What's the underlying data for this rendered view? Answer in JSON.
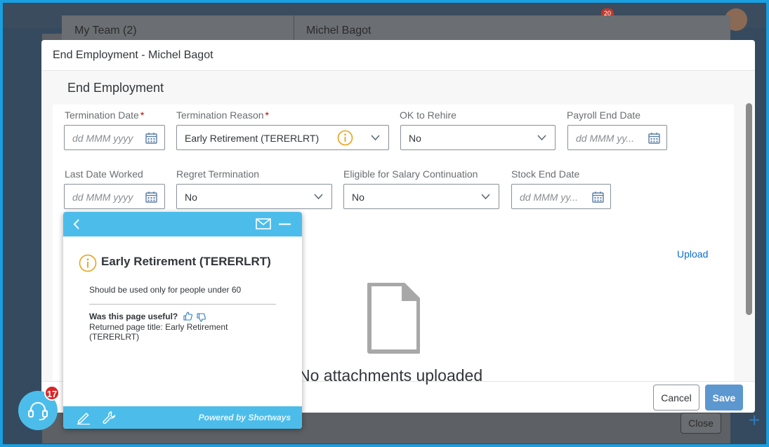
{
  "background": {
    "logo_text": "",
    "search_placeholder": "",
    "notification_count": "20",
    "team_label": "My Team (2)",
    "employee_name": "Michel Bagot",
    "close_label": "Close",
    "plus_label": "+"
  },
  "dialog": {
    "title": "End Employment - Michel Bagot",
    "section_title": "End Employment",
    "fields": {
      "termination_date": {
        "label": "Termination Date",
        "required": "*",
        "placeholder": "dd MMM yyyy"
      },
      "termination_reason": {
        "label": "Termination Reason",
        "required": "*",
        "value": "Early Retirement (TERERLRT)"
      },
      "ok_to_rehire": {
        "label": "OK to Rehire",
        "value": "No"
      },
      "payroll_end_date": {
        "label": "Payroll End Date",
        "placeholder": "dd MMM yy..."
      },
      "last_date_worked": {
        "label": "Last Date Worked",
        "placeholder": "dd MMM yyyy"
      },
      "regret_termination": {
        "label": "Regret Termination",
        "value": "No"
      },
      "eligible_salary_continuation": {
        "label": "Eligible for Salary Continuation",
        "value": "No"
      },
      "stock_end_date": {
        "label": "Stock End Date",
        "placeholder": "dd MMM yy..."
      }
    },
    "attachments": {
      "upload_label": "Upload",
      "empty_text": "No attachments uploaded"
    },
    "footer": {
      "cancel_label": "Cancel",
      "save_label": "Save"
    }
  },
  "help_popup": {
    "title": "Early Retirement (TERERLRT)",
    "description": "Should be used only for people under 60",
    "useful_question": "Was this page useful?",
    "returned_title": "Returned page title: Early Retirement (TERERLRT)",
    "powered_by": "Powered by Shortways"
  },
  "support": {
    "badge_count": "17"
  },
  "colors": {
    "frame": "#1a9fe0",
    "popup_accent": "#4cbdea",
    "info_icon": "#e8a317",
    "save_button": "#5d97d0",
    "link": "#0a6ed1",
    "required": "#bb0000",
    "badge": "#d92626"
  },
  "icons": [
    "calendar-icon",
    "chevron-down-icon",
    "info-icon",
    "document-icon",
    "back-icon",
    "mail-icon",
    "minimize-icon",
    "thumbs-up-icon",
    "thumbs-down-icon",
    "pencil-icon",
    "wrench-icon",
    "headset-icon"
  ]
}
